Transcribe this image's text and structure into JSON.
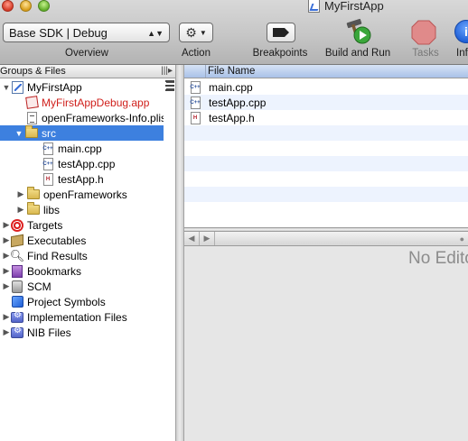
{
  "window": {
    "title": "MyFirstApp"
  },
  "toolbar": {
    "sdk_popup": "Base SDK | Debug",
    "overview_label": "Overview",
    "action_label": "Action",
    "breakpoints_label": "Breakpoints",
    "build_run_label": "Build and Run",
    "tasks_label": "Tasks",
    "info_label": "Info"
  },
  "sidebar": {
    "header": "Groups & Files",
    "items": [
      {
        "label": "MyFirstApp",
        "icon": "project-icon"
      },
      {
        "label": "MyFirstAppDebug.app",
        "icon": "app-icon"
      },
      {
        "label": "openFrameworks-Info.plist",
        "icon": "plist-icon"
      },
      {
        "label": "src",
        "icon": "folder-icon"
      },
      {
        "label": "main.cpp",
        "icon": "cpp-file-icon"
      },
      {
        "label": "testApp.cpp",
        "icon": "cpp-file-icon"
      },
      {
        "label": "testApp.h",
        "icon": "header-file-icon"
      },
      {
        "label": "openFrameworks",
        "icon": "folder-icon"
      },
      {
        "label": "libs",
        "icon": "folder-icon"
      },
      {
        "label": "Targets",
        "icon": "target-icon"
      },
      {
        "label": "Executables",
        "icon": "executables-icon"
      },
      {
        "label": "Find Results",
        "icon": "magnifier-icon"
      },
      {
        "label": "Bookmarks",
        "icon": "bookmark-icon"
      },
      {
        "label": "SCM",
        "icon": "scm-icon"
      },
      {
        "label": "Project Symbols",
        "icon": "symbols-icon"
      },
      {
        "label": "Implementation Files",
        "icon": "smart-group-icon"
      },
      {
        "label": "NIB Files",
        "icon": "smart-group-icon"
      }
    ]
  },
  "file_list": {
    "column_header": "File Name",
    "files": [
      {
        "name": "main.cpp",
        "icon": "cpp-file-icon"
      },
      {
        "name": "testApp.cpp",
        "icon": "cpp-file-icon"
      },
      {
        "name": "testApp.h",
        "icon": "header-file-icon"
      }
    ]
  },
  "editor": {
    "placeholder": "No Editor"
  },
  "colors": {
    "selection": "#3d80df",
    "debug_app_text": "#d0201c",
    "row_stripe": "#edf3fe"
  }
}
